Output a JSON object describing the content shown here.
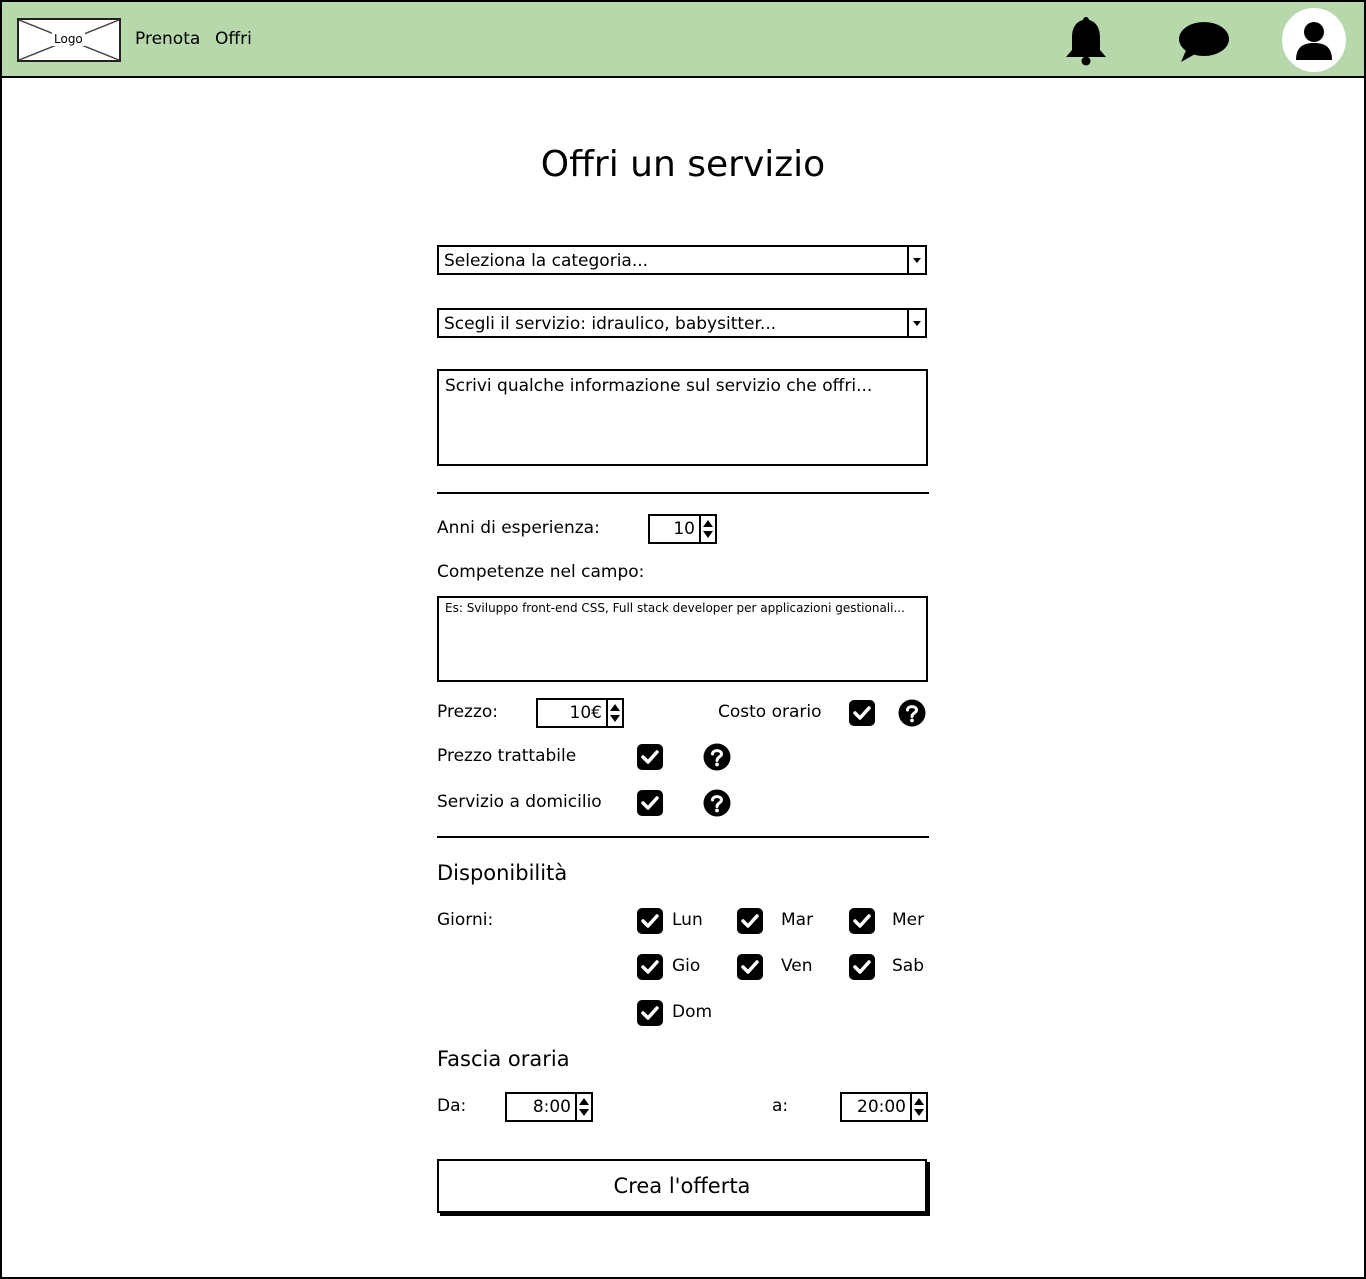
{
  "header": {
    "logo_label": "Logo",
    "nav": [
      "Prenota",
      "Offri"
    ],
    "icons": [
      "bell-icon",
      "chat-icon",
      "user-icon"
    ],
    "accent_color": "#b6d8ab"
  },
  "title": "Offri un servizio",
  "form": {
    "category_placeholder": "Seleziona la categoria...",
    "service_placeholder": "Scegli il servizio: idraulico, babysitter...",
    "description_placeholder": "Scrivi qualche informazione sul servizio che offri...",
    "experience_label": "Anni di esperienza:",
    "experience_value": "10",
    "skills_label": "Competenze nel campo:",
    "skills_placeholder": "Es: Sviluppo front-end CSS, Full stack developer per applicazioni gestionali...",
    "price_label": "Prezzo:",
    "price_value": "10€",
    "hourly_label": "Costo orario",
    "hourly_checked": true,
    "negotiable_label": "Prezzo trattabile",
    "negotiable_checked": true,
    "home_label": "Servizio a domicilio",
    "home_checked": true
  },
  "availability": {
    "title": "Disponibilità",
    "days_label": "Giorni:",
    "days": [
      {
        "label": "Lun",
        "checked": true
      },
      {
        "label": "Mar",
        "checked": true
      },
      {
        "label": "Mer",
        "checked": true
      },
      {
        "label": "Gio",
        "checked": true
      },
      {
        "label": "Ven",
        "checked": true
      },
      {
        "label": "Sab",
        "checked": true
      },
      {
        "label": "Dom",
        "checked": true
      }
    ],
    "time_title": "Fascia oraria",
    "from_label": "Da:",
    "from_value": "8:00",
    "to_label": "a:",
    "to_value": "20:00"
  },
  "submit_label": "Crea l'offerta"
}
